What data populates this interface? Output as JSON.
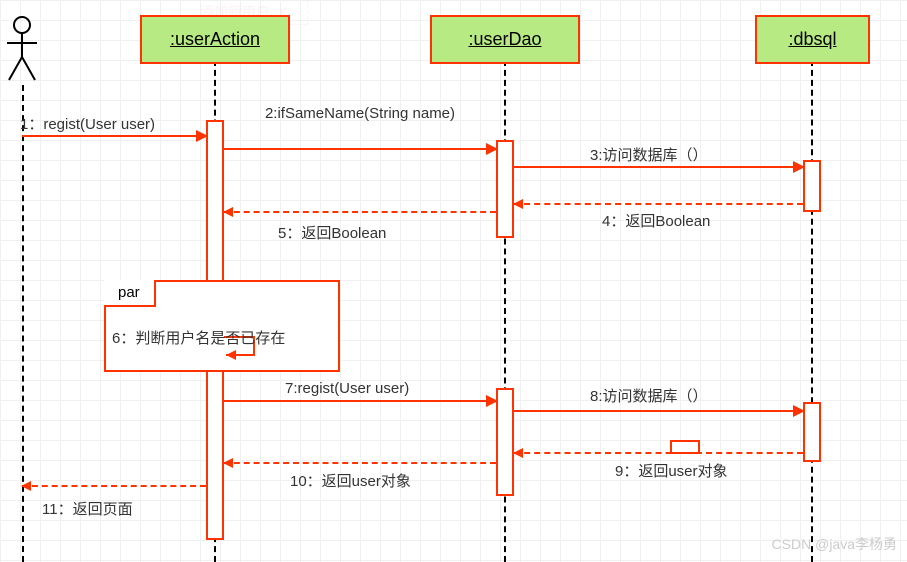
{
  "lifelines": {
    "userAction": ":userAction",
    "userDao": ":userDao",
    "dbsql": ":dbsql"
  },
  "fragment": {
    "par": "par"
  },
  "messages": {
    "m1": "1：regist(User user)",
    "m2": "2:ifSameName(String name)",
    "m3": "3:访问数据库（）",
    "m4": "4：返回Boolean",
    "m5": "5：返回Boolean",
    "m6": "6：判断用户名是否已存在",
    "m7": "7:regist(User user)",
    "m8": "8:访问数据库（）",
    "m9": "9：返回user对象",
    "m10": "10：返回user对象",
    "m11": "11：返回页面"
  },
  "fadedTop": "添加新用户 :X",
  "watermark": "CSDN @java李杨勇"
}
